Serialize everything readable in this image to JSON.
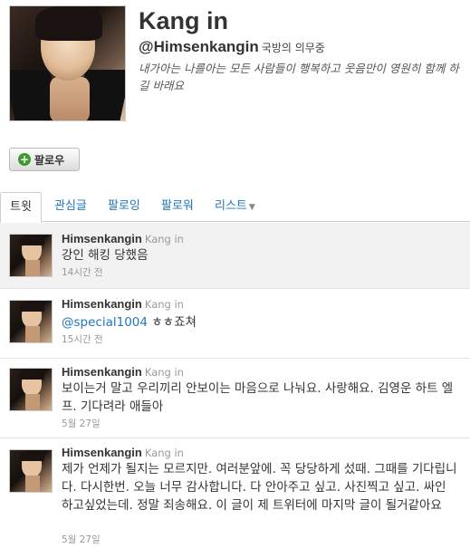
{
  "profile": {
    "name": "Kang in",
    "handle": "@Himsenkangin",
    "location": "국방의 의무중",
    "bio": "내가아는 나를아는 모든 사람들이 행복하고 웃음만이 영원히 함께 하길 바래요",
    "follow_label": "팔로우"
  },
  "tabs": [
    {
      "label": "트윗"
    },
    {
      "label": "관심글"
    },
    {
      "label": "팔로잉"
    },
    {
      "label": "팔로워"
    },
    {
      "label": "리스트"
    }
  ],
  "tweets": [
    {
      "name": "Himsenkangin",
      "display": "Kang in",
      "text": "강인 해킹 당했음",
      "time": "14시간 전"
    },
    {
      "name": "Himsenkangin",
      "display": "Kang in",
      "mention": "@special1004",
      "text": " ㅎㅎ죠쳐",
      "time": "15시간 전"
    },
    {
      "name": "Himsenkangin",
      "display": "Kang in",
      "text": "보이는거 말고 우리끼리 안보이는 마음으로 나눠요. 사랑해요. 김영운 하트 엘프. 기다려라 애들아",
      "time": "5월 27일"
    },
    {
      "name": "Himsenkangin",
      "display": "Kang in",
      "text": "제가 언제가 될지는 모르지만. 여러분앞에. 꼭 당당하게 섰때. 그때를 기다립니다. 다시한번. 오늘 너무 감사합니다. 다 안아주고 싶고. 사진찍고 싶고. 싸인 하고싶었는데. 정말 죄송해요. 이 글이 제 트위터에 마지막 글이 될거같아요",
      "time": "5월 27일"
    }
  ]
}
